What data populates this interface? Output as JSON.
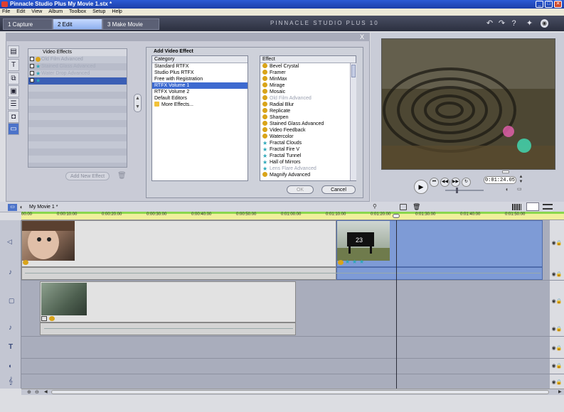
{
  "window": {
    "title": "Pinnacle Studio Plus   My Movie 1.stx *",
    "min": "_",
    "max": "□",
    "close": "✕"
  },
  "menu": [
    "File",
    "Edit",
    "View",
    "Album",
    "Toolbox",
    "Setup",
    "Help"
  ],
  "modes": [
    {
      "label": "1 Capture"
    },
    {
      "label": "2 Edit"
    },
    {
      "label": "3 Make Movie"
    }
  ],
  "brand": "PINNACLE STUDIO PLUS 10",
  "album": {
    "close": "X",
    "list_title": "Video Effects",
    "effects": [
      {
        "label": "Old Film Advanced",
        "state": "dim"
      },
      {
        "label": "Stained Glass Advanced",
        "state": "dim"
      },
      {
        "label": "Water Drop Advanced",
        "state": "dim"
      },
      {
        "label": "",
        "state": "selected"
      }
    ],
    "add_button": "Add New Effect"
  },
  "dialog": {
    "title": "Add Video Effect",
    "category_header": "Category",
    "categories": [
      {
        "label": "Standard RTFX"
      },
      {
        "label": "Studio Plus RTFX"
      },
      {
        "label": "Free with Registration"
      },
      {
        "label": "RTFX Volume 1",
        "selected": true
      },
      {
        "label": "RTFX Volume 2"
      },
      {
        "label": "Default Editors"
      },
      {
        "label": "More Effects..."
      }
    ],
    "effect_header": "Effect",
    "effects": [
      {
        "label": "Bevel Crystal",
        "icon": "gold"
      },
      {
        "label": "Framer",
        "icon": "gold"
      },
      {
        "label": "MinMax",
        "icon": "gold"
      },
      {
        "label": "Mirage",
        "icon": "gold"
      },
      {
        "label": "Mosaic",
        "icon": "gold"
      },
      {
        "label": "Old Film Advanced",
        "icon": "gold",
        "dim": true
      },
      {
        "label": "Radial Blur",
        "icon": "gold"
      },
      {
        "label": "Replicate",
        "icon": "gold"
      },
      {
        "label": "Sharpen",
        "icon": "gold"
      },
      {
        "label": "Stained Glass Advanced",
        "icon": "gold"
      },
      {
        "label": "Video Feedback",
        "icon": "gold"
      },
      {
        "label": "Watercolor",
        "icon": "gold"
      },
      {
        "label": "Fractal Clouds",
        "icon": "star"
      },
      {
        "label": "Fractal Fire V",
        "icon": "star"
      },
      {
        "label": "Fractal Tunnel",
        "icon": "star"
      },
      {
        "label": "Hall of Mirrors",
        "icon": "star"
      },
      {
        "label": "Lens Flare Advanced",
        "icon": "star",
        "dim": true
      },
      {
        "label": "Magnify Advanced",
        "icon": "gold"
      }
    ],
    "ok": "OK",
    "cancel": "Cancel"
  },
  "player": {
    "timecode": "0:01:24.05"
  },
  "timeline": {
    "project": "My Movie 1 *",
    "ruler": [
      "00.00",
      "0:00:10.00",
      "0:00:20.00",
      "0:00:30.00",
      "0:00:40.00",
      "0:00:50.00",
      "0:01:00.00",
      "0:01:10.00",
      "0:01:20.00",
      "0:01:30.00",
      "0:01:40.00",
      "0:01:50.00"
    ]
  },
  "colors": {
    "accent": "#3d6ad0",
    "selection_blue": "#7e9bd6",
    "ruler": "#f0f09c"
  }
}
